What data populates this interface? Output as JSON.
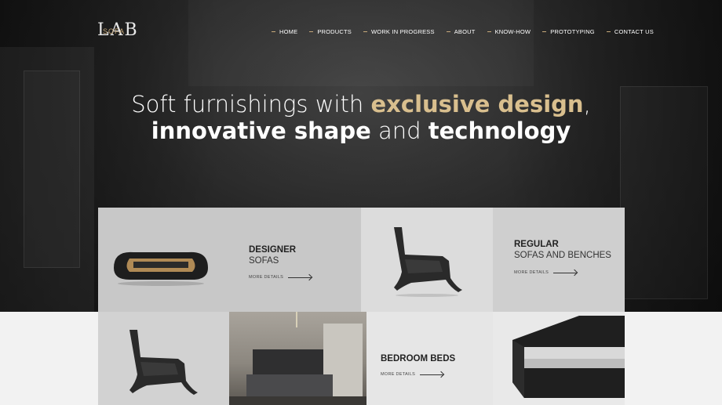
{
  "brand": {
    "logo_main": "LAB",
    "logo_sub": "SOFA"
  },
  "nav": {
    "items": [
      "HOME",
      "PRODUCTS",
      "WORK IN PROGRESS",
      "ABOUT",
      "KNOW-HOW",
      "PROTOTYPING",
      "CONTACT US"
    ]
  },
  "hero": {
    "line1_a": "Soft furnishings with ",
    "line1_b": "exclusive design",
    "line1_c": ",",
    "line2_a": "innovative shape",
    "line2_b": " and ",
    "line2_c": "technology"
  },
  "categories": [
    {
      "strong": "DESIGNER",
      "light": "SOFAS",
      "more": "MORE DETAILS"
    },
    {
      "strong": "REGULAR",
      "light": "SOFAS AND BENCHES",
      "more": "MORE DETAILS"
    },
    {
      "strong": "BEDROOM BEDS",
      "light": "",
      "more": "MORE DETAILS"
    }
  ],
  "colors": {
    "accent": "#c7a97a",
    "headline_gold": "#d9bf8e",
    "hero_bg": "#2e2e2e"
  }
}
